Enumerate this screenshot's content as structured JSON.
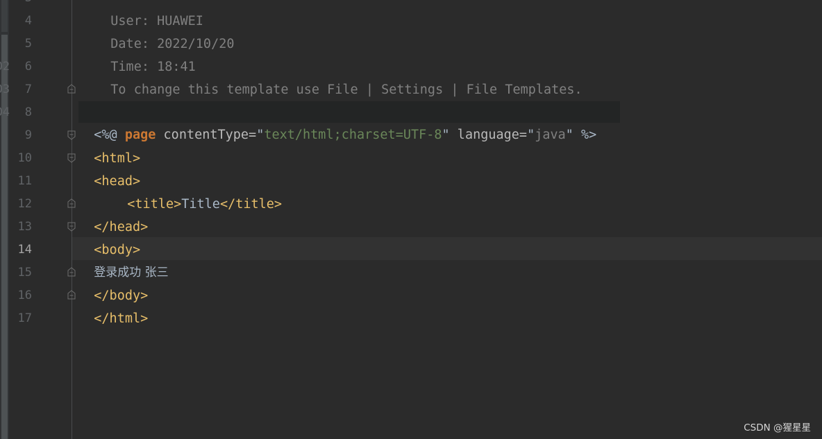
{
  "editor": {
    "clipped_numbers": [
      "02",
      "03",
      "04"
    ],
    "line_numbers": [
      "3",
      "4",
      "5",
      "6",
      "7",
      "8",
      "9",
      "10",
      "11",
      "12",
      "13",
      "14",
      "15",
      "16",
      "17"
    ],
    "current_line": "14",
    "lines": {
      "l3": "User: HUAWEI",
      "l4": "Date: 2022/10/20",
      "l5": "Time: 18:41",
      "l6": "To change this template use File | Settings | File Templates.",
      "l7": "--%>",
      "l8": {
        "open": "<%@ ",
        "keyword": "page",
        "attr1": " contentType=",
        "q1": "\"",
        "val1": "text/html;charset=UTF-8",
        "q2": "\"",
        "attr2": " language=",
        "q3": "\"",
        "val2": "java",
        "q4": "\"",
        "close": " %>"
      },
      "l9": "<html>",
      "l10": "<head>",
      "l11": {
        "open_tag": "<title>",
        "text": "Title",
        "close_tag": "</title>"
      },
      "l12": "</head>",
      "l13": "<body>",
      "l14": "登录成功 张三",
      "l15": "</body>",
      "l16": "</html>"
    }
  },
  "watermark": "CSDN @猩星星",
  "colors": {
    "background": "#2b2b2b",
    "comment": "#808080",
    "tag": "#e8bf6a",
    "keyword": "#cc7832",
    "string": "#6a8759"
  },
  "icons": [
    "fold-start-icon",
    "fold-end-icon"
  ]
}
